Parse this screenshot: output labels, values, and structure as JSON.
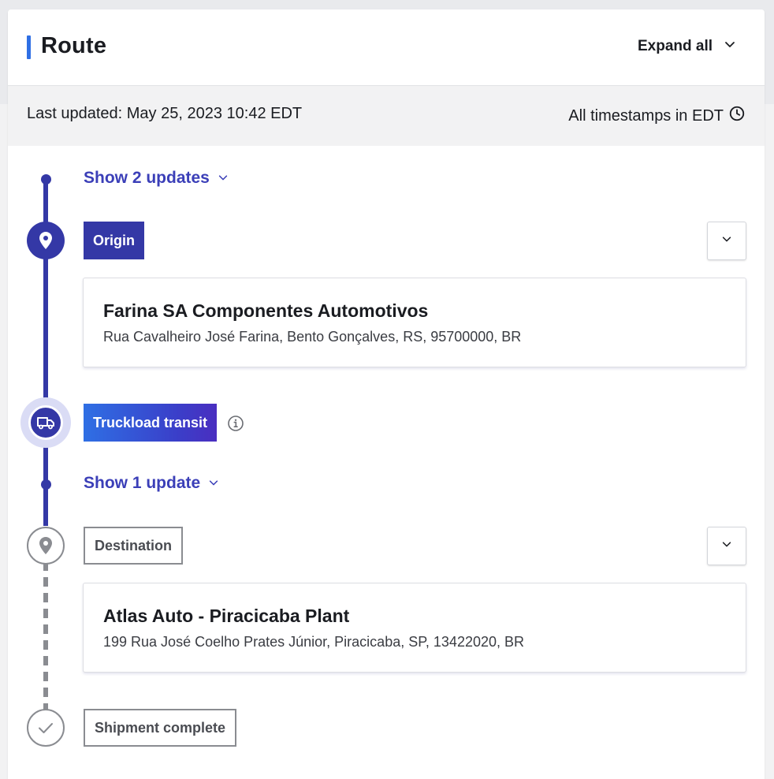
{
  "header": {
    "title": "Route",
    "expand_all_label": "Expand all"
  },
  "subbar": {
    "last_updated": "Last updated: May 25, 2023 10:42 EDT",
    "timezone_note": "All timestamps in EDT"
  },
  "timeline": {
    "show_updates_1": "Show 2 updates",
    "origin": {
      "tag": "Origin",
      "name": "Farina SA Componentes Automotivos",
      "address": "Rua Cavalheiro José Farina, Bento Gonçalves, RS, 95700000, BR"
    },
    "transit": {
      "tag": "Truckload transit"
    },
    "show_updates_2": "Show 1 update",
    "destination": {
      "tag": "Destination",
      "name": "Atlas Auto - Piracicaba Plant",
      "address": "199 Rua José Coelho Prates Júnior, Piracicaba, SP, 13422020, BR"
    },
    "complete": {
      "tag": "Shipment complete"
    }
  },
  "icons": {
    "expand": "chevron-down-icon",
    "clock": "clock-icon",
    "origin": "map-pin-icon",
    "transit": "truck-icon",
    "info": "info-icon",
    "destination": "map-pin-icon",
    "complete": "check-icon"
  },
  "colors": {
    "accent": "#2f6fe4",
    "primary": "#3438a6",
    "link": "#3b3fb8",
    "muted": "#8a8c91"
  }
}
